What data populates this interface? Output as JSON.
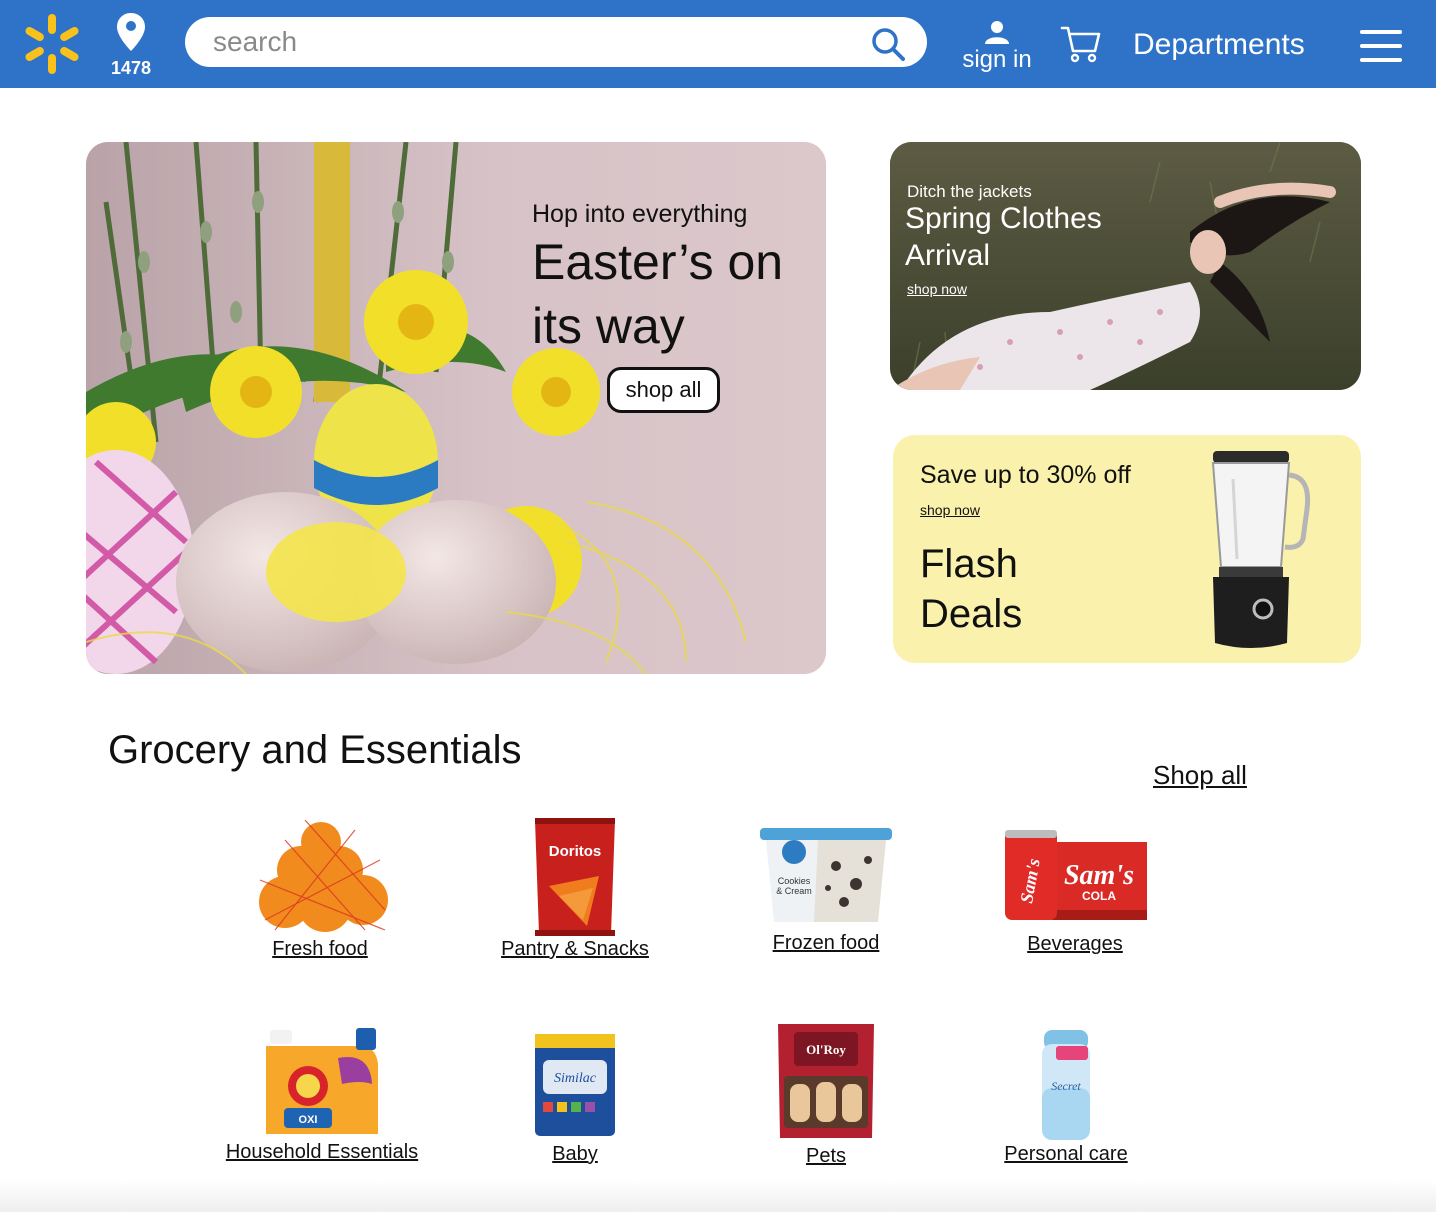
{
  "header": {
    "store_number": "1478",
    "search_placeholder": "search",
    "sign_in_label": "sign in",
    "departments_label": "Departments",
    "colors": {
      "bar": "#2f73c8",
      "spark": "#f9c21a"
    }
  },
  "hero": {
    "kicker": "Hop into everything",
    "title": "Easter’s on its way",
    "button_label": "shop all"
  },
  "promo_spring": {
    "kicker": "Ditch the jackets",
    "title": "Spring Clothes Arrival",
    "link": "shop now"
  },
  "promo_flash": {
    "kicker": "Save up to 30% off",
    "link": "shop now",
    "title": "Flash Deals",
    "background": "#f9f1ac"
  },
  "grocery": {
    "title": "Grocery and Essentials",
    "shop_all": "Shop all",
    "categories": [
      {
        "label": "Fresh food",
        "icon": "oranges-image"
      },
      {
        "label": "Pantry & Snacks",
        "icon": "chips-bag-image"
      },
      {
        "label": "Frozen food",
        "icon": "ice-cream-tub-image"
      },
      {
        "label": "Beverages",
        "icon": "cola-pack-image"
      },
      {
        "label": "Household Essentials",
        "icon": "detergent-jug-image"
      },
      {
        "label": "Baby",
        "icon": "formula-can-image"
      },
      {
        "label": "Pets",
        "icon": "dog-treats-bag-image"
      },
      {
        "label": "Personal care",
        "icon": "deodorant-image"
      }
    ]
  }
}
